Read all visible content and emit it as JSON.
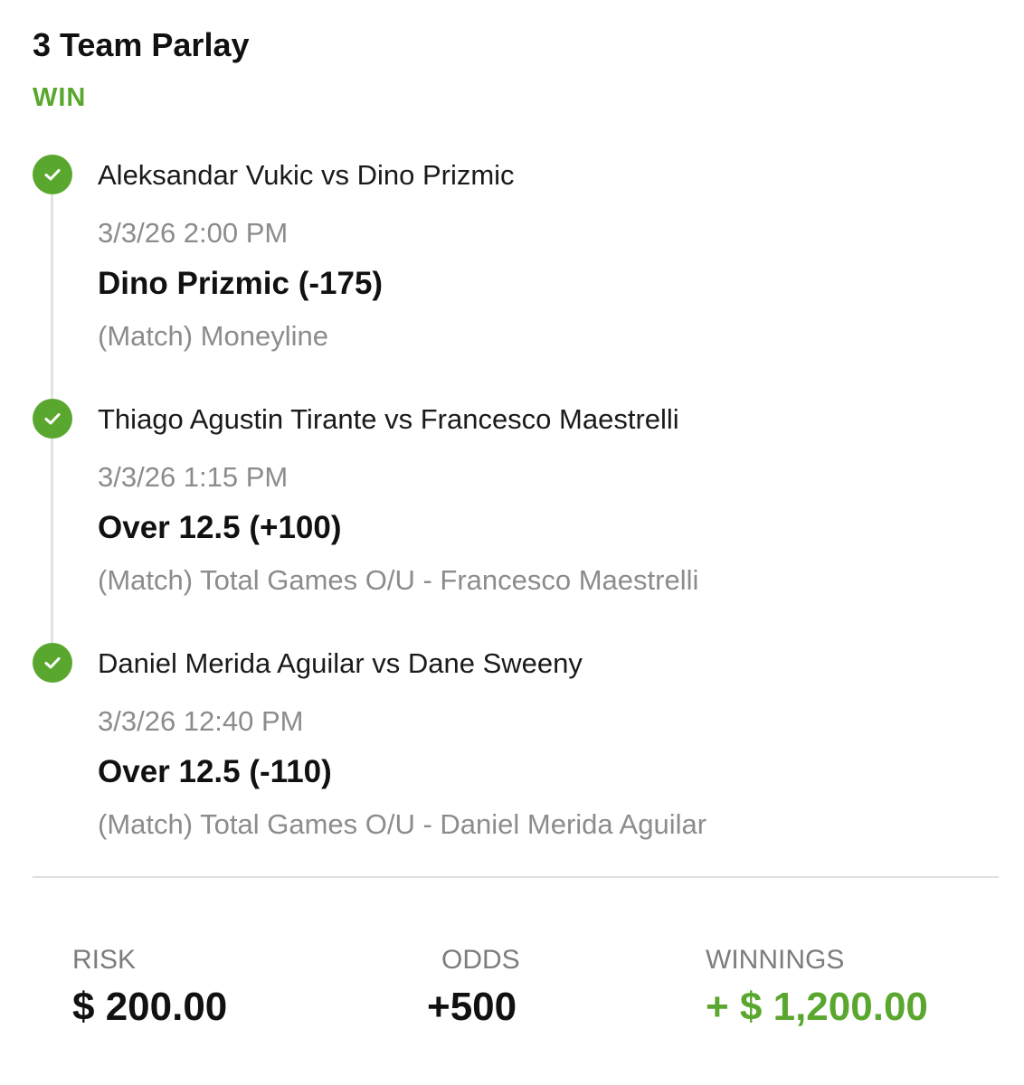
{
  "bet": {
    "title": "3 Team Parlay",
    "status": "WIN"
  },
  "legs": [
    {
      "matchup": "Aleksandar Vukic vs Dino Prizmic",
      "datetime": "3/3/26 2:00 PM",
      "pick": "Dino Prizmic (-175)",
      "market": "(Match) Moneyline",
      "result_icon": "check-circle-icon"
    },
    {
      "matchup": "Thiago Agustin Tirante vs Francesco Maestrelli",
      "datetime": "3/3/26 1:15 PM",
      "pick": "Over 12.5 (+100)",
      "market": "(Match) Total Games O/U - Francesco Maestrelli",
      "result_icon": "check-circle-icon"
    },
    {
      "matchup": "Daniel Merida Aguilar vs Dane Sweeny",
      "datetime": "3/3/26 12:40 PM",
      "pick": "Over 12.5 (-110)",
      "market": "(Match) Total Games O/U - Daniel Merida Aguilar",
      "result_icon": "check-circle-icon"
    }
  ],
  "summary": {
    "risk_label": "RISK",
    "risk_value": "$ 200.00",
    "odds_label": "ODDS",
    "odds_value": "+500",
    "winnings_label": "WINNINGS",
    "winnings_value": "+ $ 1,200.00"
  },
  "colors": {
    "win_green": "#5aa72f",
    "muted_text": "#8c8c8c",
    "primary_text": "#111111"
  }
}
